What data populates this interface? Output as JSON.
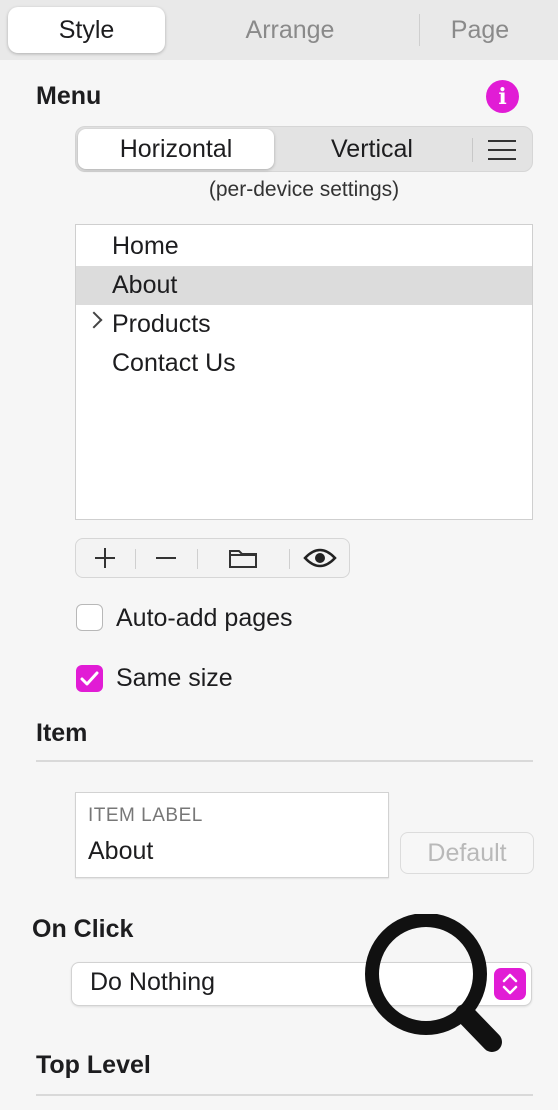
{
  "tabs": [
    {
      "label": "Style",
      "active": true
    },
    {
      "label": "Arrange",
      "active": false
    },
    {
      "label": "Page",
      "active": false
    }
  ],
  "menu": {
    "title": "Menu",
    "orientation": {
      "horizontal": "Horizontal",
      "vertical": "Vertical",
      "selected": "Horizontal"
    },
    "note": "(per-device settings)",
    "items": [
      {
        "label": "Home",
        "selected": false,
        "has_children": false
      },
      {
        "label": "About",
        "selected": true,
        "has_children": false
      },
      {
        "label": "Products",
        "selected": false,
        "has_children": true
      },
      {
        "label": "Contact Us",
        "selected": false,
        "has_children": false
      }
    ],
    "toolbar_icons": [
      "plus-icon",
      "minus-icon",
      "folder-icon",
      "eye-icon"
    ],
    "auto_add_pages": {
      "label": "Auto-add pages",
      "checked": false
    },
    "same_size": {
      "label": "Same size",
      "checked": true
    }
  },
  "item": {
    "title": "Item",
    "label_caption": "ITEM LABEL",
    "label_value": "About",
    "default_button": "Default"
  },
  "on_click": {
    "title": "On Click",
    "value": "Do Nothing"
  },
  "top_level": {
    "title": "Top Level"
  },
  "colors": {
    "accent": "#e11cd5",
    "panel_bg": "#f6f6f6"
  }
}
